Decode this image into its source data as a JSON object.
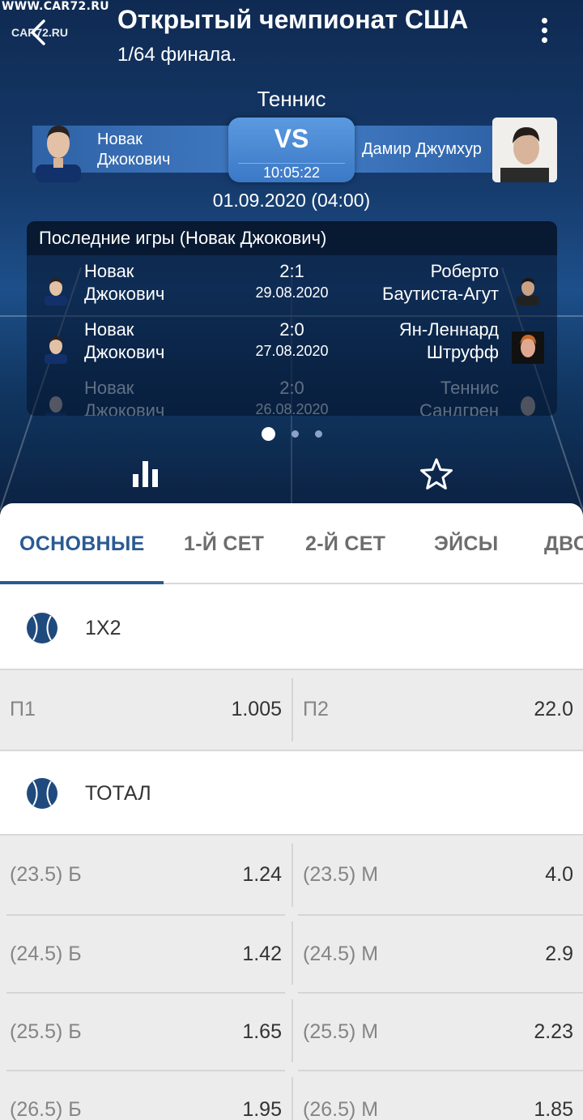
{
  "watermark": "WWW.CAR72.RU",
  "watermark_small": "CAR72.RU",
  "header": {
    "title": "Открытый чемпионат США",
    "subtitle": "1/64 финала.",
    "sport": "Теннис"
  },
  "matchup": {
    "home_player": "Новак Джокович",
    "away_player": "Дамир Джумхур",
    "vs_label": "VS",
    "timer": "10:05:22",
    "datetime": "01.09.2020 (04:00)"
  },
  "recent_games": {
    "title": "Последние игры (Новак Джокович)",
    "matches": [
      {
        "home": "Новак Джокович",
        "score": "2:1",
        "date": "29.08.2020",
        "away": "Роберто Баутиста-Агут"
      },
      {
        "home": "Новак Джокович",
        "score": "2:0",
        "date": "27.08.2020",
        "away": "Ян-Леннард Штруфф"
      },
      {
        "home": "Новак Джокович",
        "score": "2:0",
        "date": "26.08.2020",
        "away": "Теннис Сандгрен"
      }
    ]
  },
  "carousel": {
    "pages": 3,
    "active": 1
  },
  "icons": {
    "stats": "bar-chart-icon",
    "favorite": "star-outline-icon",
    "back": "back-arrow-icon",
    "menu": "kebab-menu-icon",
    "section": "tennis-ball-icon"
  },
  "colors": {
    "accent": "#2a5a93",
    "header_bg": "#163b6c"
  },
  "tabs": [
    {
      "label": "ОСНОВНЫЕ",
      "active": true
    },
    {
      "label": "1-Й СЕТ",
      "active": false
    },
    {
      "label": "2-Й СЕТ",
      "active": false
    },
    {
      "label": "ЭЙСЫ",
      "active": false
    },
    {
      "label": "ДВОЙНЫЕ",
      "active": false
    }
  ],
  "markets": {
    "onex2": {
      "label": "1X2",
      "odds": [
        {
          "left_label": "П1",
          "left_value": "1.005",
          "right_label": "П2",
          "right_value": "22.0"
        }
      ]
    },
    "total": {
      "label": "ТОТАЛ",
      "odds": [
        {
          "left_label": "(23.5) Б",
          "left_value": "1.24",
          "right_label": "(23.5) М",
          "right_value": "4.0"
        },
        {
          "left_label": "(24.5) Б",
          "left_value": "1.42",
          "right_label": "(24.5) М",
          "right_value": "2.9"
        },
        {
          "left_label": "(25.5) Б",
          "left_value": "1.65",
          "right_label": "(25.5) М",
          "right_value": "2.23"
        },
        {
          "left_label": "(26.5) Б",
          "left_value": "1.95",
          "right_label": "(26.5) М",
          "right_value": "1.85"
        }
      ]
    }
  }
}
